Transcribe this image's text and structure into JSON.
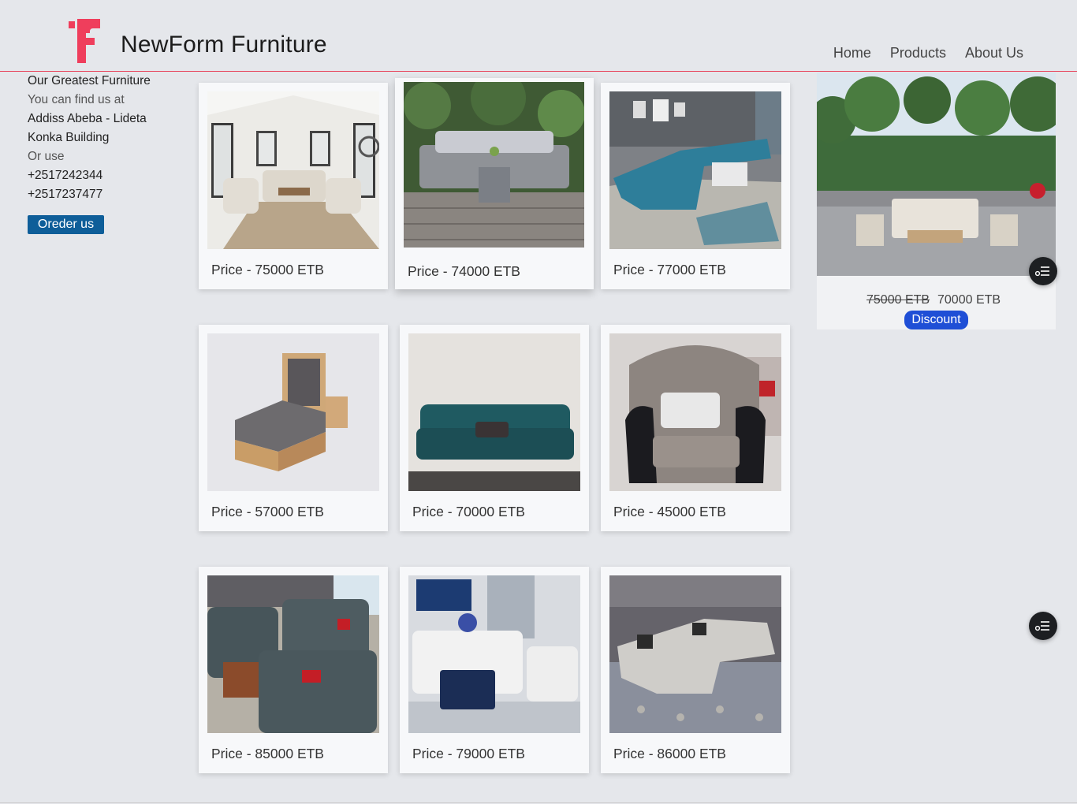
{
  "brand": {
    "name": "NewForm Furniture",
    "logo_icon": "f-logo-icon",
    "logo_color": "#ef3e5c"
  },
  "nav": {
    "home": "Home",
    "products": "Products",
    "about": "About Us"
  },
  "sidebar": {
    "heading": "Our Greatest Furniture",
    "find_us": "You can find us at",
    "address_line1": "Addiss Abeba - Lideta",
    "address_line2": "Konka Building",
    "or_use": "Or use",
    "phone1": "+2517242344",
    "phone2": "+2517237477",
    "order_button": "Oreder us"
  },
  "products": [
    {
      "price": "Price - 75000 ETB",
      "image": "white-living-room"
    },
    {
      "price": "Price - 74000 ETB",
      "image": "grey-wicker-patio-set"
    },
    {
      "price": "Price - 77000 ETB",
      "image": "teal-sectional-sofa"
    },
    {
      "price": "Price - 57000 ETB",
      "image": "wooden-bed"
    },
    {
      "price": "Price - 70000 ETB",
      "image": "teal-velvet-sofa"
    },
    {
      "price": "Price - 45000 ETB",
      "image": "tufted-armchair"
    },
    {
      "price": "Price - 85000 ETB",
      "image": "grey-sofa-set"
    },
    {
      "price": "Price - 79000 ETB",
      "image": "white-sofa-navy-ottoman"
    },
    {
      "price": "Price - 86000 ETB",
      "image": "grey-l-sectional"
    }
  ],
  "promo": {
    "image": "outdoor-patio-set",
    "old_price": "75000 ETB",
    "new_price": "70000 ETB",
    "discount_button": "Discount"
  },
  "fab_icon": "filter-list-icon",
  "colors": {
    "accent_line": "#e7475e",
    "order_button": "#0e5e99",
    "discount_button": "#1f4fd6"
  }
}
